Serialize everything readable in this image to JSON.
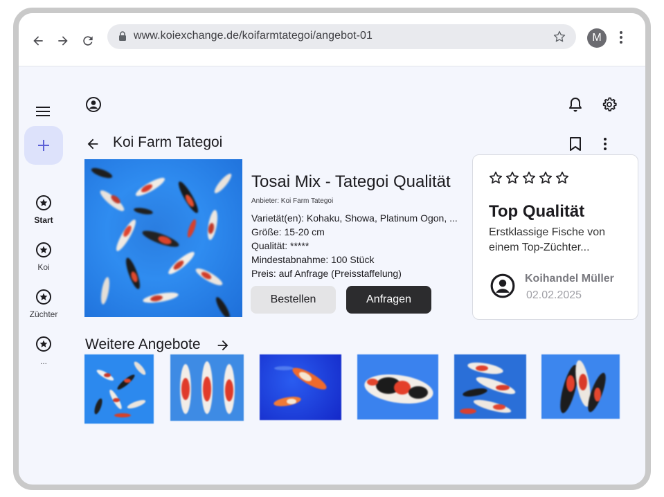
{
  "browser": {
    "url": "www.koiexchange.de/koifarmtategoi/angebot-01",
    "profile_initial": "M"
  },
  "rail": {
    "items": [
      {
        "label": "Start",
        "icon": "star-circle-icon",
        "active": true
      },
      {
        "label": "Koi",
        "icon": "star-circle-icon",
        "active": false
      },
      {
        "label": "Züchter",
        "icon": "star-circle-icon",
        "active": false
      },
      {
        "label": "...",
        "icon": "star-circle-icon",
        "active": false
      }
    ]
  },
  "header": {
    "title": "Koi Farm Tategoi"
  },
  "product": {
    "title": "Tosai Mix - Tategoi Qualität",
    "seller": "Anbieter: Koi Farm Tategoi",
    "specs": [
      "Varietät(en): Kohaku, Showa, Platinum Ogon, ...",
      "Größe: 15-20 cm",
      "Qualität: *****",
      "Mindestabnahme: 100 Stück",
      "Preis: auf Anfrage (Preisstaffelung)"
    ],
    "order_label": "Bestellen",
    "ask_label": "Anfragen"
  },
  "review_card": {
    "rating": 0,
    "max_rating": 5,
    "title": "Top Qualität",
    "description": "Erstklassige Fische von einem Top-Züchter...",
    "author": "Koihandel Müller",
    "date": "02.02.2025"
  },
  "more_offers": {
    "title": "Weitere Angebote"
  },
  "colors": {
    "accent": "#5b5fd6",
    "fab_bg": "#dde2fb",
    "primary_button": "#2c2c2e",
    "background": "#f4f6fd"
  }
}
